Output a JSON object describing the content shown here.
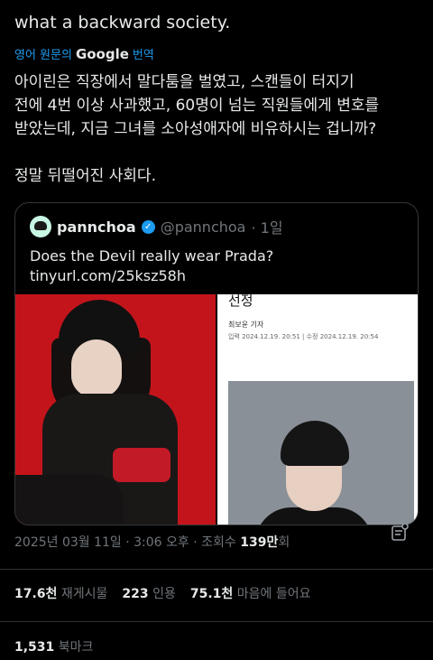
{
  "post": {
    "text": "what a backward society.",
    "translate_label": "영어 원문의",
    "translate_brand": "Google",
    "translate_suffix": "번역",
    "translation": "아이린은 직장에서 말다툼을 벌였고, 스캔들이 터지기\n전에 4번 이상 사과했고, 60명이 넘는 직원들에게 변호를\n받았는데, 지금 그녀를 소아성애자에 비유하시는 겁니까?\n\n정말 뒤떨어진 사회다."
  },
  "quote": {
    "name": "pannchoa",
    "handle": "@pannchoa",
    "time": "· 1일",
    "text": "Does the Devil really wear Prada?\ntinyurl.com/25ksz58h",
    "article_title": "선정",
    "article_author": "최보윤 기자",
    "article_meta": "입력 2024.12.19. 20:51 | 수정 2024.12.19. 20:54"
  },
  "meta": {
    "timestamp": "2025년 03월 11일 · 3:06 오후 · 조회수",
    "views": "139만",
    "views_suffix": "회"
  },
  "stats": {
    "retweets": "17.6천",
    "retweets_label": "재게시물",
    "quotes": "223",
    "quotes_label": "인용",
    "likes": "75.1천",
    "likes_label": "마음에 들어요"
  },
  "bookmarks": {
    "count": "1,531",
    "label": "북마크"
  }
}
